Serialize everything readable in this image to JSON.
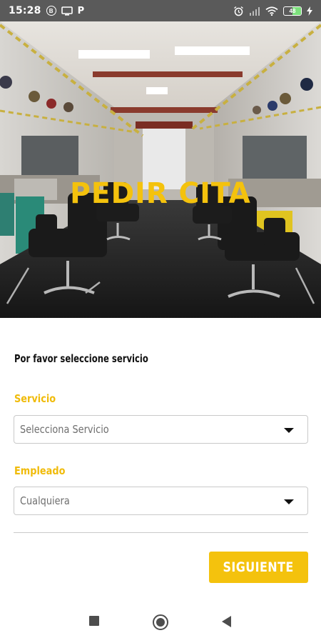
{
  "status_bar": {
    "time": "15:28",
    "left_icons": [
      "b-circle-icon",
      "cast-icon",
      "p-icon"
    ],
    "right_icons": [
      "alarm-icon",
      "signal-icon",
      "wifi-icon",
      "battery-icon",
      "charging-icon"
    ],
    "battery_text": "48",
    "battery_level_percent": 48
  },
  "hero": {
    "title": "PEDIR CITA",
    "title_color": "#f4c20d"
  },
  "form": {
    "intro": "Por favor seleccione servicio",
    "service": {
      "label": "Servicio",
      "value": "Selecciona Servicio"
    },
    "employee": {
      "label": "Empleado",
      "value": "Cualquiera"
    },
    "next_label": "SIGUIENTE",
    "accent_color": "#f4c20d"
  },
  "nav_bar": {
    "icons": [
      "recents-square-icon",
      "home-circle-icon",
      "back-triangle-icon"
    ]
  }
}
